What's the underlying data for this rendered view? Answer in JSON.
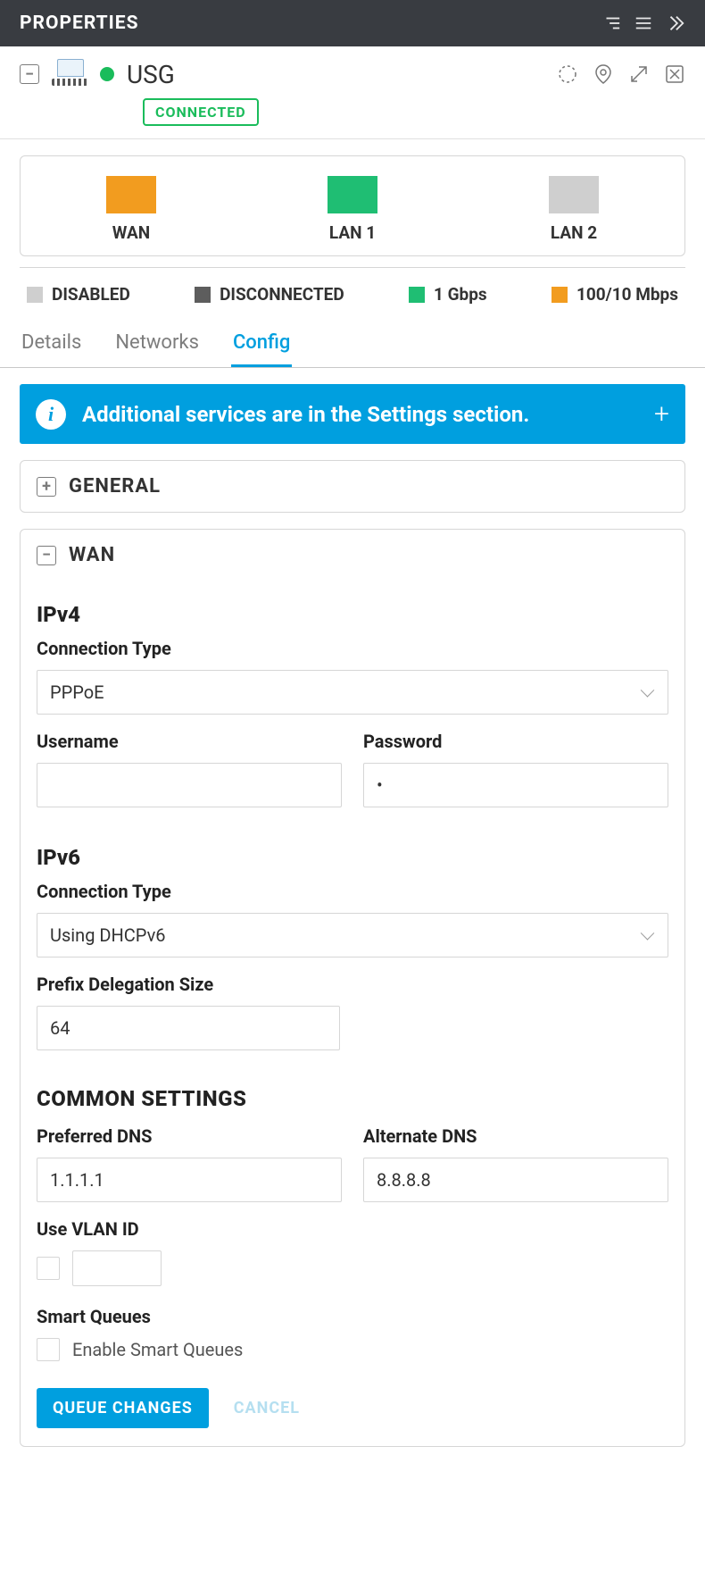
{
  "header": {
    "title": "PROPERTIES"
  },
  "device": {
    "name": "USG",
    "status_badge": "CONNECTED"
  },
  "ports": [
    {
      "label": "WAN",
      "colorClass": "port-wan"
    },
    {
      "label": "LAN 1",
      "colorClass": "port-lan1"
    },
    {
      "label": "LAN 2",
      "colorClass": "port-lan2"
    }
  ],
  "legend": [
    {
      "label": "DISABLED",
      "swatch": "sw-disabled"
    },
    {
      "label": "DISCONNECTED",
      "swatch": "sw-disconnected"
    },
    {
      "label": "1 Gbps",
      "swatch": "sw-1g"
    },
    {
      "label": "100/10 Mbps",
      "swatch": "sw-100"
    }
  ],
  "tabs": [
    {
      "label": "Details",
      "active": false
    },
    {
      "label": "Networks",
      "active": false
    },
    {
      "label": "Config",
      "active": true
    }
  ],
  "banner": {
    "text": "Additional services are in the Settings section."
  },
  "sections": {
    "general": {
      "title": "GENERAL"
    },
    "wan": {
      "title": "WAN",
      "ipv4": {
        "heading": "IPv4",
        "connection_type_label": "Connection Type",
        "connection_type_value": "PPPoE",
        "username_label": "Username",
        "username_value": "",
        "password_label": "Password",
        "password_value": "•"
      },
      "ipv6": {
        "heading": "IPv6",
        "connection_type_label": "Connection Type",
        "connection_type_value": "Using DHCPv6",
        "prefix_label": "Prefix Delegation Size",
        "prefix_value": "64"
      },
      "common": {
        "heading": "COMMON SETTINGS",
        "preferred_dns_label": "Preferred DNS",
        "preferred_dns_value": "1.1.1.1",
        "alternate_dns_label": "Alternate DNS",
        "alternate_dns_value": "8.8.8.8",
        "vlan_label": "Use VLAN ID",
        "vlan_value": "",
        "smart_queues_heading": "Smart Queues",
        "smart_queues_checkbox_label": "Enable Smart Queues"
      }
    }
  },
  "actions": {
    "queue": "QUEUE CHANGES",
    "cancel": "CANCEL"
  }
}
